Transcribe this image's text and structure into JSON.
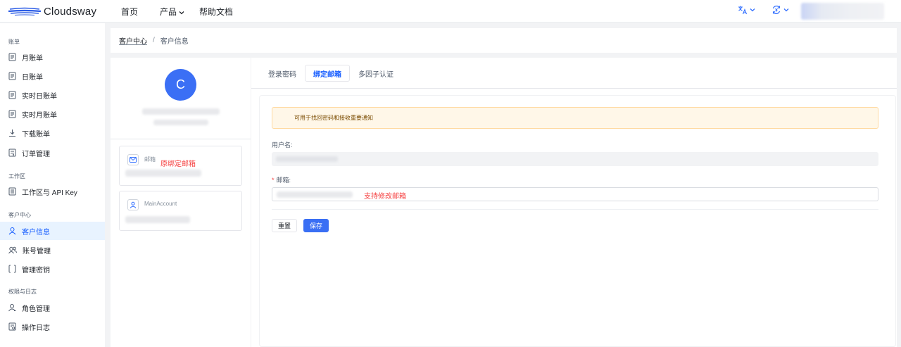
{
  "header": {
    "brand": "Cloudsway",
    "nav": [
      {
        "label": "首页",
        "has_dropdown": false
      },
      {
        "label": "产品",
        "has_dropdown": true
      },
      {
        "label": "帮助文档",
        "has_dropdown": false
      }
    ],
    "icons": [
      "translate-icon",
      "currency-icon"
    ],
    "accent_color": "#3370ff"
  },
  "sidebar": {
    "groups": [
      {
        "title": "账单",
        "items": [
          {
            "label": "月账单",
            "icon": "bill-icon"
          },
          {
            "label": "日账单",
            "icon": "bill-icon"
          },
          {
            "label": "实时日账单",
            "icon": "bill-icon"
          },
          {
            "label": "实时月账单",
            "icon": "bill-icon"
          },
          {
            "label": "下载账单",
            "icon": "download-icon"
          },
          {
            "label": "订单管理",
            "icon": "order-icon"
          }
        ]
      },
      {
        "title": "工作区",
        "items": [
          {
            "label": "工作区与 API Key",
            "icon": "workspace-icon"
          }
        ]
      },
      {
        "title": "客户中心",
        "items": [
          {
            "label": "客户信息",
            "icon": "user-icon",
            "active": true
          },
          {
            "label": "账号管理",
            "icon": "users-icon"
          },
          {
            "label": "管理密钥",
            "icon": "key-icon"
          }
        ]
      },
      {
        "title": "权限与日志",
        "items": [
          {
            "label": "角色管理",
            "icon": "role-icon"
          },
          {
            "label": "操作日志",
            "icon": "log-icon"
          }
        ]
      }
    ],
    "active_color": "#165dff"
  },
  "breadcrumb": {
    "parent": "客户中心",
    "separator": "/",
    "current": "客户信息"
  },
  "profile": {
    "avatar_letter": "C",
    "avatar_color": "#3b6ff5",
    "email_card": {
      "label": "邮箱",
      "annotation": "原绑定邮箱",
      "icon": "mail-icon"
    },
    "account_card": {
      "label": "MainAccount",
      "icon": "user-icon"
    }
  },
  "tabs": [
    {
      "label": "登录密码",
      "active": false
    },
    {
      "label": "绑定邮箱",
      "active": true
    },
    {
      "label": "多因子认证",
      "active": false
    }
  ],
  "form": {
    "notice": "可用于找回密码和接收重要通知",
    "username_label": "用户名:",
    "email_label": "邮箱:",
    "email_required_mark": "*",
    "email_annotation": "支持修改邮箱",
    "reset_label": "重置",
    "save_label": "保存"
  }
}
